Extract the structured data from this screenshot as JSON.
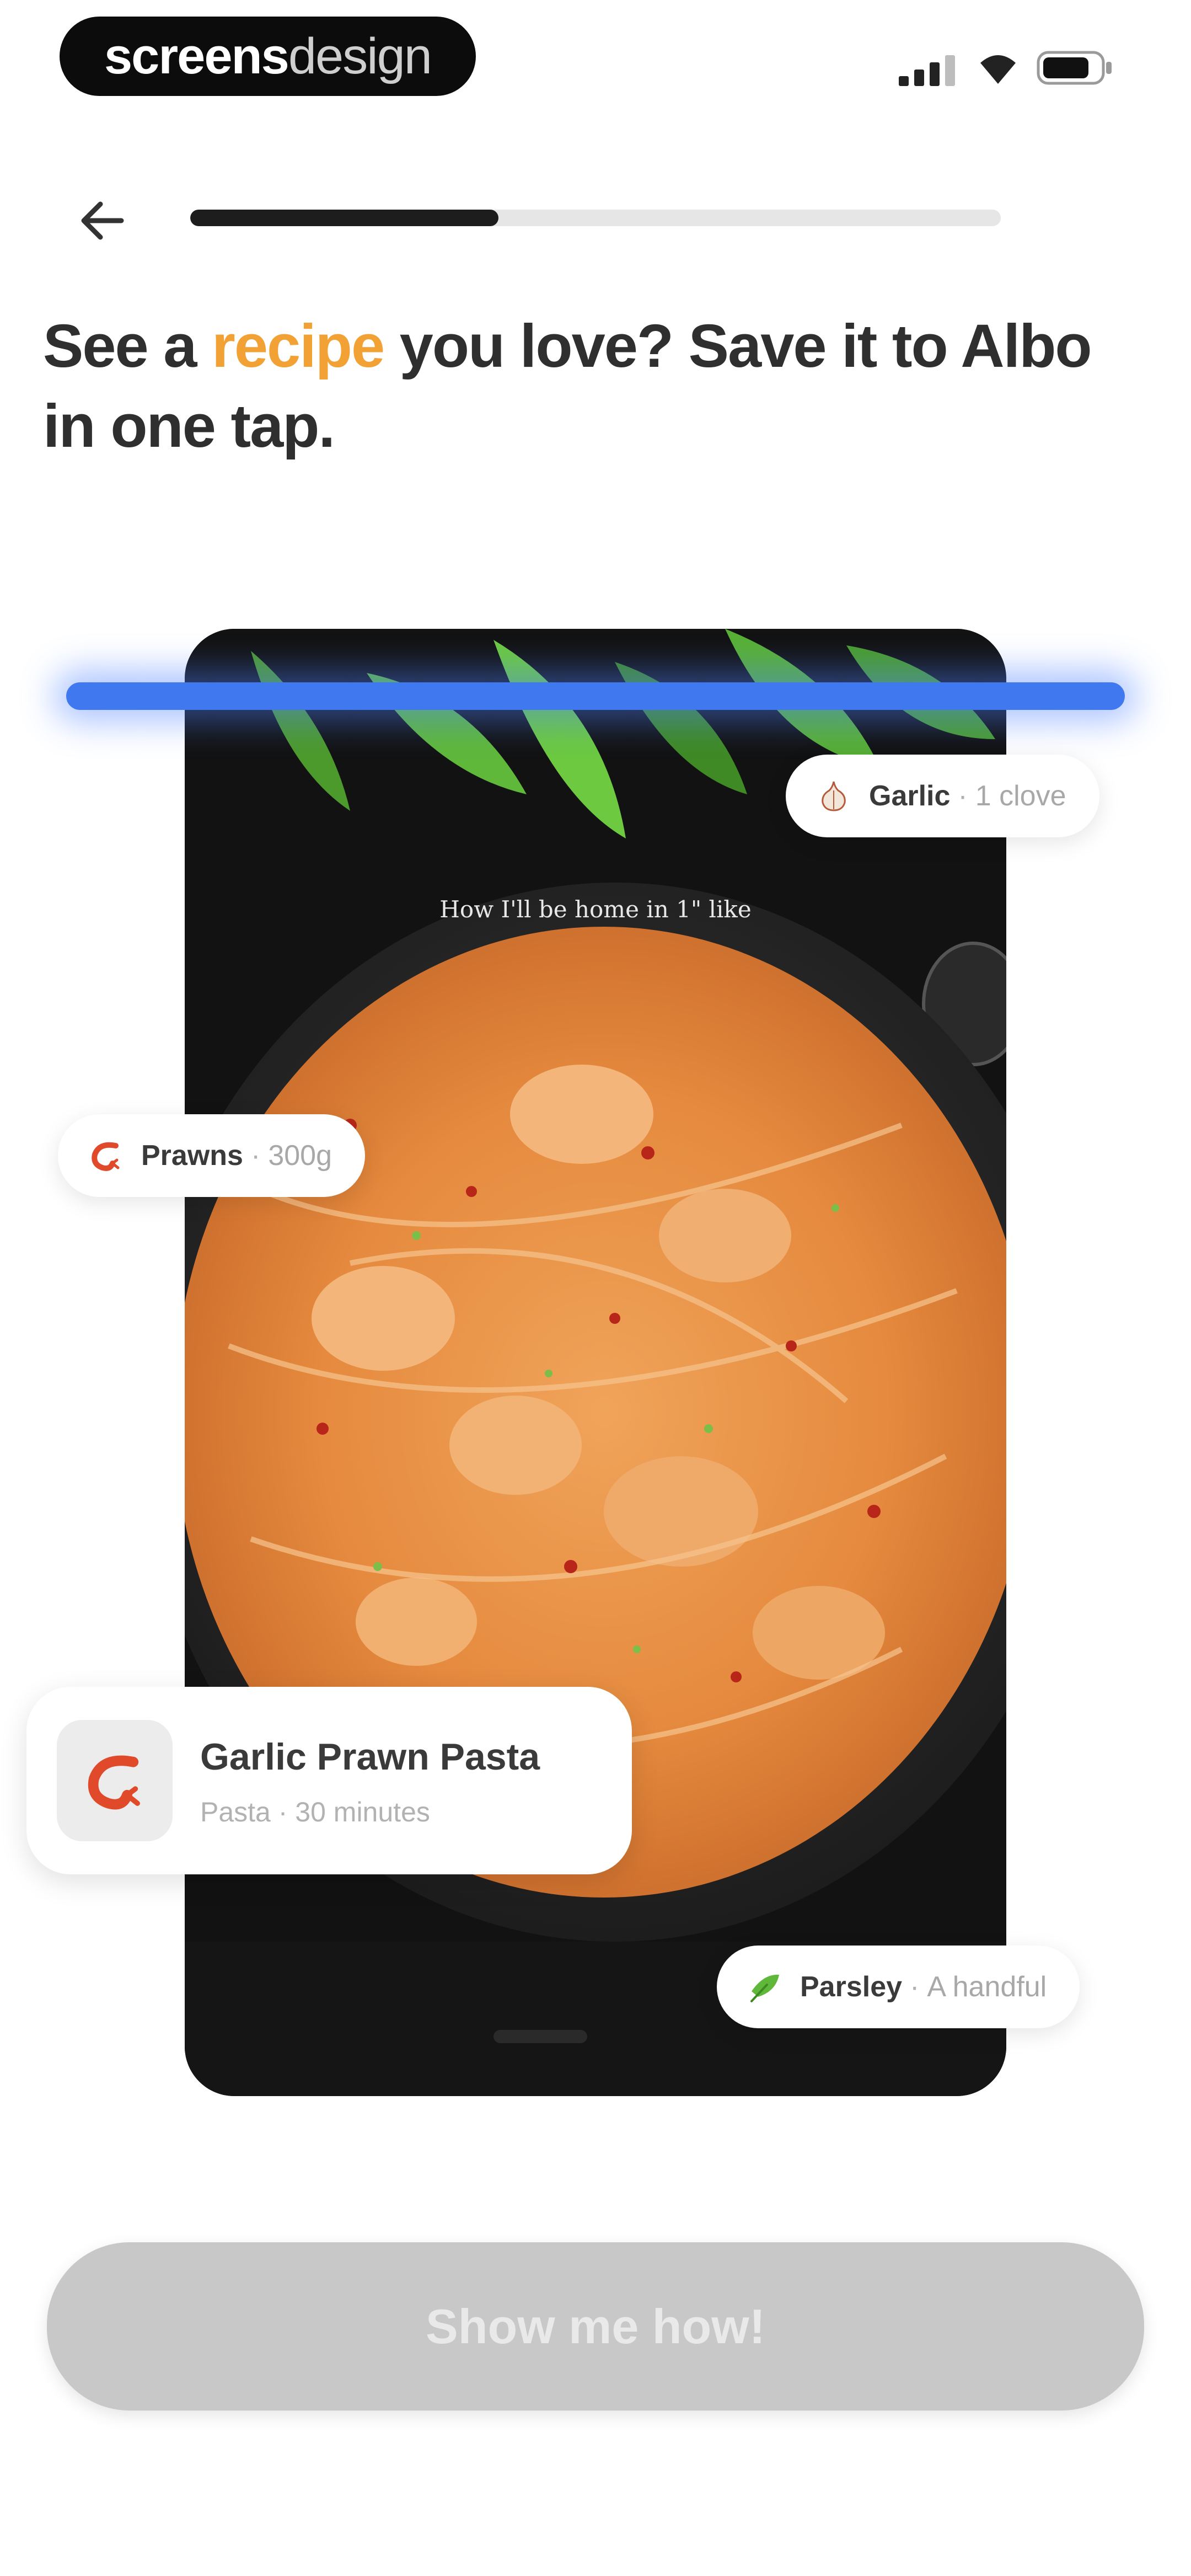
{
  "status_bar": {
    "brand_bold": "screens",
    "brand_light": "design",
    "icons": [
      "signal-icon",
      "wifi-icon",
      "battery-icon"
    ]
  },
  "header": {
    "back_icon": "arrow-left-icon",
    "progress": 0.38
  },
  "headline": {
    "before": "See a ",
    "accent": "recipe",
    "after": " you love? Save it to Albo in one tap.",
    "accent_color": "#f2a134"
  },
  "photo": {
    "caption": "How I'll be home in 1\" like"
  },
  "ingredients": [
    {
      "name": "Garlic",
      "separator": " · ",
      "quantity": "1 clove",
      "icon": "garlic-icon"
    },
    {
      "name": "Prawns",
      "separator": " · ",
      "quantity": "300g",
      "icon": "prawn-icon"
    },
    {
      "name": "Parsley",
      "separator": " · ",
      "quantity": "A handful",
      "icon": "parsley-icon"
    }
  ],
  "recipe_card": {
    "title": "Garlic Prawn Pasta",
    "subtitle": "Pasta · 30 minutes",
    "icon": "prawn-icon"
  },
  "cta": {
    "label": "Show me how!"
  },
  "colors": {
    "accent": "#f2a134",
    "scan_line": "#3f78ef",
    "cta_disabled": "#c8c8c8"
  }
}
